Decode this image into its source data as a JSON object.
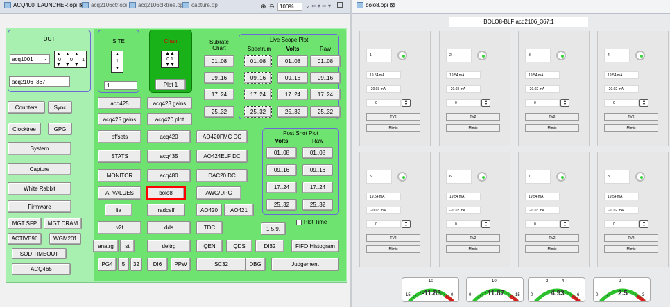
{
  "tabs_left": [
    {
      "label": "ACQ400_LAUNCHER.opi",
      "close": "⊠"
    },
    {
      "label": "acq2106ctr.opi"
    },
    {
      "label": "acq2106clktree.opi"
    },
    {
      "label": "capture.opi"
    }
  ],
  "toolbar": {
    "zoom": "100%",
    "zoom_in": "⊕",
    "zoom_out": "⊖",
    "arrows": "⌄  ⇦ ▾  ⇨ ▾"
  },
  "tabs_right": [
    {
      "label": "bolo8.opi",
      "close": "⊠"
    }
  ],
  "uut": {
    "title": "UUT",
    "selected": "acq1001",
    "digits": [
      "0",
      "0",
      "1"
    ],
    "host": "acq2106_367"
  },
  "site": {
    "title": "SITE",
    "value": "1",
    "input": "1"
  },
  "chan": {
    "title": "Chan",
    "digits": [
      "0",
      "1"
    ],
    "plot": "Plot 1"
  },
  "subrate": {
    "title": "Subrate\nChart",
    "buttons": [
      "01..08",
      "09..16",
      "17..24",
      "25..32"
    ]
  },
  "live_scope": {
    "title": "Live Scope Plot",
    "headers": [
      "Spectrum",
      "Volts",
      "Raw"
    ],
    "rows": [
      [
        "01..08",
        "01..08",
        "01..08"
      ],
      [
        "09..16",
        "09..16",
        "09..16"
      ],
      [
        "17..24",
        "17..24",
        "17..24"
      ],
      [
        "25..32",
        "25..32",
        "25..32"
      ]
    ]
  },
  "post_shot": {
    "title": "Post Shot Plot",
    "headers": [
      "Volts",
      "Raw"
    ],
    "rows": [
      [
        "01..08",
        "01..08"
      ],
      [
        "09..16",
        "09..16"
      ],
      [
        "17..24",
        "17..24"
      ],
      [
        "25..32",
        "25..32"
      ]
    ],
    "plot_time": "Plot Time"
  },
  "left_buttons": {
    "counters": "Counters",
    "sync": "Sync",
    "clocktree": "Clocktree",
    "gpg": "GPG",
    "system": "System",
    "capture": "Capture",
    "white_rabbit": "White Rabbit",
    "firmware": "Firmware",
    "mgt_sfp": "MGT SFP",
    "mgt_dram": "MGT DRAM",
    "active96": "ACTIVE96",
    "wgm201": "WGM201",
    "sod_timeout": "SOD TIMEOUT",
    "acq465": "ACQ465"
  },
  "main_buttons": {
    "acq425": "acq425",
    "acq423_gains": "acq423 gains",
    "acq425_gains": "acq425 gains",
    "acq420_plot": "acq420 plot",
    "offsets": "offsets",
    "acq420": "acq420",
    "ao420fmc_dc": "AO420FMC DC",
    "stats": "STATS",
    "acq435": "acq435",
    "ao424elf_dc": "AO424ELF DC",
    "monitor": "MONITOR",
    "acq480": "acq480",
    "dac20_dc": "DAC20 DC",
    "ai_values": "AI VALUES",
    "bolo8": "bolo8",
    "awg_dpg": "AWG/DPG",
    "lia": "lia",
    "radcelf": "radcelf",
    "ao420": "AO420",
    "ao421": "AO421",
    "v2f": "v2f",
    "dds": "dds",
    "tdc": "TDC",
    "one59": "1,5,9,",
    "anatrg": "anatrg",
    "st": "st",
    "deltrg": "deltrg",
    "qen": "QEN",
    "qds": "QDS",
    "di32": "DI32",
    "fifo_histogram": "FIFO Histogram",
    "pg4": "PG4",
    "five": "5",
    "thirtytwo": "32",
    "di6": "DI6",
    "ppw": "PPW",
    "sc32": "SC32",
    "dbg": "DBG",
    "judgement": "Judgement"
  },
  "bolo": {
    "title": "BOLO8-BLF  acq2106_367:1",
    "channels": [
      {
        "n": "1",
        "current": "19.54 mA",
        "offset": "-20.03 mA",
        "spin": "0",
        "tv": "TV2",
        "mimic": "Mimic"
      },
      {
        "n": "2",
        "current": "19.54 mA",
        "offset": "-20.03 mA",
        "spin": "0",
        "tv": "TV2",
        "mimic": "Mimic"
      },
      {
        "n": "3",
        "current": "19.54 mA",
        "offset": "-20.02 mA",
        "spin": "0",
        "tv": "TV2",
        "mimic": "Mimic"
      },
      {
        "n": "4",
        "current": "19.54 mA",
        "offset": "-20.02 mA",
        "spin": "0",
        "tv": "TV2",
        "mimic": "Mimic"
      },
      {
        "n": "5",
        "current": "19.54 mA",
        "offset": "-20.03 mA",
        "spin": "0",
        "tv": "TV2",
        "mimic": "Mimic"
      },
      {
        "n": "6",
        "current": "19.54 mA",
        "offset": "-20.02 mA",
        "spin": "0",
        "tv": "TV2",
        "mimic": "Mimic"
      },
      {
        "n": "7",
        "current": "19.54 mA",
        "offset": "-20.03 mA",
        "spin": "0",
        "tv": "TV2",
        "mimic": "Mimic"
      },
      {
        "n": "8",
        "current": "19.54 mA",
        "offset": "-20.02 mA",
        "spin": "0",
        "tv": "TV2",
        "mimic": "Mimic"
      }
    ],
    "meters": [
      {
        "value": "-11.83",
        "ticks": [
          "-15",
          "-10",
          "0"
        ]
      },
      {
        "value": "11.87",
        "ticks": [
          "0",
          "10",
          "15"
        ]
      },
      {
        "value": "4.93",
        "ticks": [
          "0",
          "2",
          "4",
          "6"
        ]
      },
      {
        "value": "2.5",
        "ticks": [
          "0",
          "2",
          "3"
        ]
      }
    ]
  },
  "colors": {
    "outer_green": "#a8f0b0",
    "inner_green": "#6fe36f",
    "chan_green": "#19b319",
    "highlight": "#ff0000"
  }
}
